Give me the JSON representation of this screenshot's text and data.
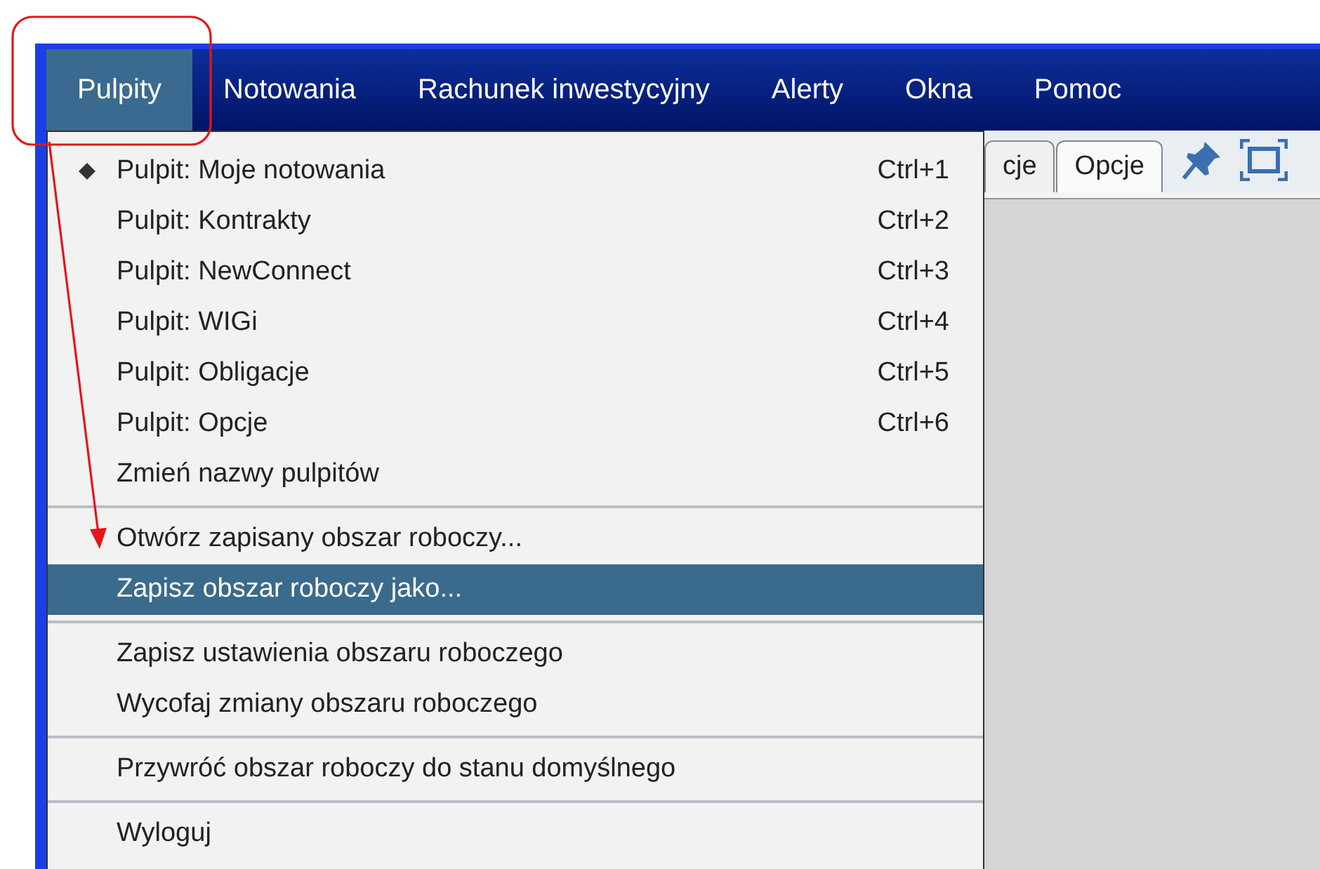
{
  "menubar": [
    {
      "label": "Pulpity",
      "selected": true
    },
    {
      "label": "Notowania",
      "selected": false
    },
    {
      "label": "Rachunek inwestycyjny",
      "selected": false
    },
    {
      "label": "Alerty",
      "selected": false
    },
    {
      "label": "Okna",
      "selected": false
    },
    {
      "label": "Pomoc",
      "selected": false
    }
  ],
  "tabs": [
    {
      "label": "cje",
      "selected": false
    },
    {
      "label": "Opcje",
      "selected": true
    }
  ],
  "menu": {
    "groups": [
      {
        "items": [
          {
            "label": "Pulpit: Moje notowania",
            "shortcut": "Ctrl+1",
            "checked": true,
            "selected": false
          },
          {
            "label": "Pulpit: Kontrakty",
            "shortcut": "Ctrl+2",
            "checked": false,
            "selected": false
          },
          {
            "label": "Pulpit: NewConnect",
            "shortcut": "Ctrl+3",
            "checked": false,
            "selected": false
          },
          {
            "label": "Pulpit: WIGi",
            "shortcut": "Ctrl+4",
            "checked": false,
            "selected": false
          },
          {
            "label": "Pulpit: Obligacje",
            "shortcut": "Ctrl+5",
            "checked": false,
            "selected": false
          },
          {
            "label": "Pulpit: Opcje",
            "shortcut": "Ctrl+6",
            "checked": false,
            "selected": false
          },
          {
            "label": "Zmień nazwy pulpitów",
            "checked": false,
            "selected": false
          }
        ]
      },
      {
        "items": [
          {
            "label": "Otwórz zapisany obszar roboczy...",
            "checked": false,
            "selected": false
          },
          {
            "label": "Zapisz obszar roboczy jako...",
            "checked": false,
            "selected": true
          }
        ]
      },
      {
        "items": [
          {
            "label": "Zapisz ustawienia obszaru roboczego",
            "checked": false,
            "selected": false
          },
          {
            "label": "Wycofaj zmiany obszaru roboczego",
            "checked": false,
            "selected": false
          }
        ]
      },
      {
        "items": [
          {
            "label": "Przywróć obszar roboczy do stanu domyślnego",
            "checked": false,
            "selected": false
          }
        ]
      },
      {
        "items": [
          {
            "label": "Wyloguj",
            "checked": false,
            "selected": false
          }
        ]
      }
    ]
  }
}
